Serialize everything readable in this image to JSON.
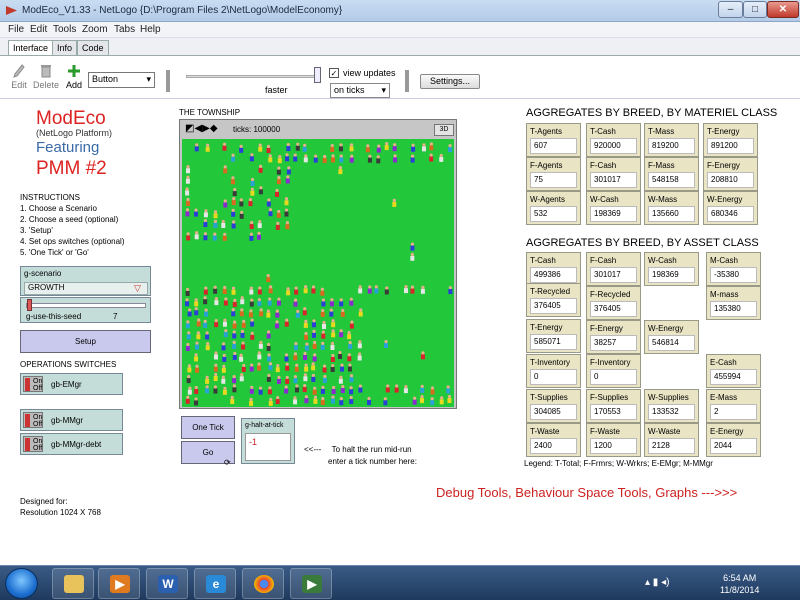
{
  "window": {
    "title": "ModEco_V1.33 - NetLogo {D:\\Program Files 2\\NetLogo\\ModelEconomy}",
    "min": "–",
    "max": "□",
    "close": "✕"
  },
  "menu": [
    "File",
    "Edit",
    "Tools",
    "Zoom",
    "Tabs",
    "Help"
  ],
  "tabs": [
    "Interface",
    "Info",
    "Code"
  ],
  "toolbar": {
    "edit": "Edit",
    "delete": "Delete",
    "add": "Add",
    "widget_type": "Button",
    "speed_label": "faster",
    "view_updates": "view updates",
    "update_mode": "on ticks",
    "settings": "Settings...",
    "view_updates_checked": true
  },
  "left": {
    "title": "ModEco",
    "platform": "(NetLogo Platform)",
    "featuring": "Featuring",
    "subtitle": "PMM #2",
    "instructions": [
      "INSTRUCTIONS",
      "1. Choose a Scenario",
      "2. Choose a seed (optional)",
      "3. 'Setup'",
      "4. Set ops switches (optional)",
      "5. 'One Tick' or 'Go'"
    ],
    "scenario_label": "g-scenario",
    "scenario_value": "GROWTH",
    "seed_label": "g-use-this-seed",
    "seed_value": "7",
    "setup": "Setup",
    "ops_title": "OPERATIONS SWITCHES",
    "switch_on": "On",
    "switch_off": "Off",
    "switches": [
      "gb-EMgr",
      "gb-MMgr",
      "gb-MMgr-debt"
    ],
    "designed": [
      "Designed for:",
      "Resolution 1024 X 768"
    ]
  },
  "view": {
    "township": "THE TOWNSHIP",
    "ticks": "ticks: 100000",
    "btn3d": "3D",
    "bg_color": "#22c83a"
  },
  "controls": {
    "one_tick": "One Tick",
    "go": "Go",
    "halt_label": "g-halt-at-tick",
    "halt_value": "-1",
    "hint_arrow": "<<---",
    "hint1": "To halt the run mid-run",
    "hint2": "enter a tick number here:"
  },
  "materiel": {
    "title": "AGGREGATES BY BREED, BY MATERIEL CLASS",
    "rows": [
      [
        {
          "label": "T-Agents",
          "value": "607"
        },
        {
          "label": "T-Cash",
          "value": "920000"
        },
        {
          "label": "T-Mass",
          "value": "819200"
        },
        {
          "label": "T-Energy",
          "value": "891200"
        }
      ],
      [
        {
          "label": "F-Agents",
          "value": "75"
        },
        {
          "label": "F-Cash",
          "value": "301017"
        },
        {
          "label": "F-Mass",
          "value": "548158"
        },
        {
          "label": "F-Energy",
          "value": "208810"
        }
      ],
      [
        {
          "label": "W-Agents",
          "value": "532"
        },
        {
          "label": "W-Cash",
          "value": "198369"
        },
        {
          "label": "W-Mass",
          "value": "135660"
        },
        {
          "label": "W-Energy",
          "value": "680346"
        }
      ]
    ]
  },
  "asset": {
    "title": "AGGREGATES BY BREED, BY ASSET CLASS",
    "t_cash": {
      "label": "T-Cash",
      "value": "499386"
    },
    "f_cash": {
      "label": "F-Cash",
      "value": "301017"
    },
    "w_cash": {
      "label": "W-Cash",
      "value": "198369"
    },
    "m_cash": {
      "label": "M-Cash",
      "value": "-35380"
    },
    "t_recycled": {
      "label": "T-Recycled",
      "value": "376405"
    },
    "f_recycled": {
      "label": "F-Recycled",
      "value": "376405"
    },
    "m_mass": {
      "label": "M-mass",
      "value": "135380"
    },
    "t_energy": {
      "label": "T-Energy",
      "value": "585071"
    },
    "f_energy": {
      "label": "F-Energy",
      "value": "38257"
    },
    "w_energy": {
      "label": "W-Energy",
      "value": "546814"
    },
    "t_inventory": {
      "label": "T-Inventory",
      "value": "0"
    },
    "f_inventory": {
      "label": "F-Inventory",
      "value": "0"
    },
    "e_cash": {
      "label": "E-Cash",
      "value": "455994"
    },
    "t_supplies": {
      "label": "T-Supplies",
      "value": "304085"
    },
    "f_supplies": {
      "label": "F-Supplies",
      "value": "170553"
    },
    "w_supplies": {
      "label": "W-Supplies",
      "value": "133532"
    },
    "e_mass": {
      "label": "E-Mass",
      "value": "2"
    },
    "t_waste": {
      "label": "T-Waste",
      "value": "2400"
    },
    "f_waste": {
      "label": "F-Waste",
      "value": "1200"
    },
    "w_waste": {
      "label": "W-Waste",
      "value": "2128"
    },
    "e_energy": {
      "label": "E-Energy",
      "value": "2044"
    }
  },
  "legend": "Legend: T-Total; F-Frmrs; W-Wrkrs; E-EMgr; M-MMgr",
  "debug_link": "Debug Tools, Behaviour Space Tools, Graphs --->>>",
  "taskbar": {
    "time": "6:54 AM",
    "date": "11/8/2014",
    "word_letter": "W"
  }
}
